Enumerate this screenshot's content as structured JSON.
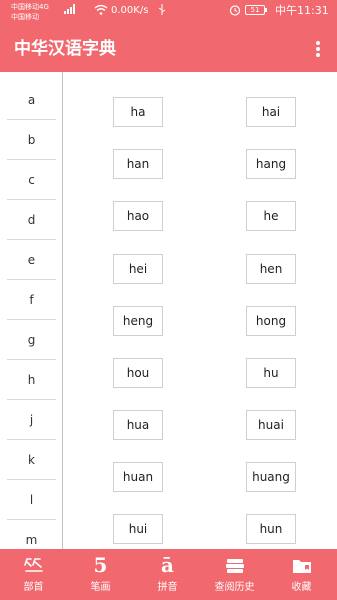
{
  "status_bar": {
    "carrier_line1": "中国移动4G",
    "carrier_line2": "中国移动",
    "net_speed": "0.00K/s",
    "battery": "51",
    "time": "中午11:31"
  },
  "app_bar": {
    "title": "中华汉语字典",
    "menu_icon": "more-vertical-icon"
  },
  "letters": [
    "a",
    "b",
    "c",
    "d",
    "e",
    "f",
    "g",
    "h",
    "j",
    "k",
    "l",
    "m"
  ],
  "pinyin": [
    "ha",
    "hai",
    "han",
    "hang",
    "hao",
    "he",
    "hei",
    "hen",
    "heng",
    "hong",
    "hou",
    "hu",
    "hua",
    "huai",
    "huan",
    "huang",
    "hui",
    "hun"
  ],
  "bottom_nav": [
    {
      "label": "部首",
      "icon": "radical-icon"
    },
    {
      "label": "笔画",
      "icon": "stroke-count-icon",
      "glyph": "5"
    },
    {
      "label": "拼音",
      "icon": "pinyin-icon",
      "glyph": "ā"
    },
    {
      "label": "查阅历史",
      "icon": "history-books-icon"
    },
    {
      "label": "收藏",
      "icon": "favorites-folder-icon"
    }
  ],
  "colors": {
    "primary": "#f1686e",
    "border": "#cfcfcf"
  }
}
